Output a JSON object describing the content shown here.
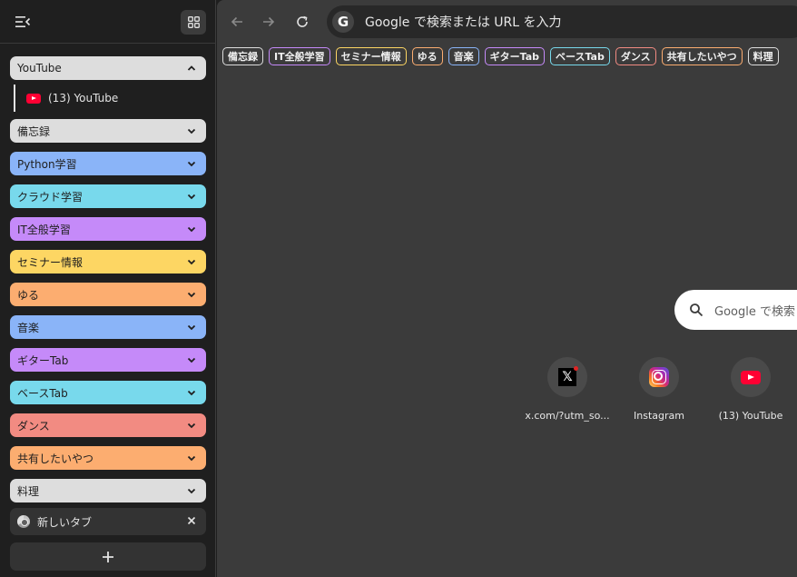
{
  "sidebar": {
    "groups": [
      {
        "label": "YouTube",
        "color": "#dddddd",
        "expanded": true
      },
      {
        "label": "備忘録",
        "color": "#dddddd"
      },
      {
        "label": "Python学習",
        "color": "#8ab4f8"
      },
      {
        "label": "クラウド学習",
        "color": "#78d9ec"
      },
      {
        "label": "IT全般学習",
        "color": "#c58af9"
      },
      {
        "label": "セミナー情報",
        "color": "#fdd663"
      },
      {
        "label": "ゆる",
        "color": "#fcad70"
      },
      {
        "label": "音楽",
        "color": "#8ab4f8"
      },
      {
        "label": "ギターTab",
        "color": "#c58af9"
      },
      {
        "label": "ベースTab",
        "color": "#78d9ec"
      },
      {
        "label": "ダンス",
        "color": "#f28b82"
      },
      {
        "label": "共有したいやつ",
        "color": "#fcad70"
      },
      {
        "label": "料理",
        "color": "#dddddd"
      }
    ],
    "youtube_tab": {
      "label": "(13) YouTube",
      "icon": "youtube-icon"
    },
    "new_tab": {
      "label": "新しいタブ",
      "icon": "chrome-icon"
    },
    "add_button_icon": "plus-icon"
  },
  "toolbar": {
    "omnibox_text": "Google で検索または URL を入力",
    "g_letter": "G"
  },
  "bookmarks": [
    {
      "label": "備忘録",
      "color": "#dddddd"
    },
    {
      "label": "IT全般学習",
      "color": "#c58af9"
    },
    {
      "label": "セミナー情報",
      "color": "#fdd663"
    },
    {
      "label": "ゆる",
      "color": "#fcad70"
    },
    {
      "label": "音楽",
      "color": "#8ab4f8"
    },
    {
      "label": "ギターTab",
      "color": "#c58af9"
    },
    {
      "label": "ベースTab",
      "color": "#78d9ec"
    },
    {
      "label": "ダンス",
      "color": "#f28b82"
    },
    {
      "label": "共有したいやつ",
      "color": "#fcad70"
    },
    {
      "label": "料理",
      "color": "#dddddd"
    }
  ],
  "newtab_page": {
    "search_placeholder": "Google で検索",
    "shortcuts": [
      {
        "label": "x.com/?utm_so...",
        "icon": "x-icon",
        "glyph": "𝕏"
      },
      {
        "label": "Instagram",
        "icon": "instagram-icon"
      },
      {
        "label": "(13) YouTube",
        "icon": "youtube-icon"
      }
    ]
  }
}
